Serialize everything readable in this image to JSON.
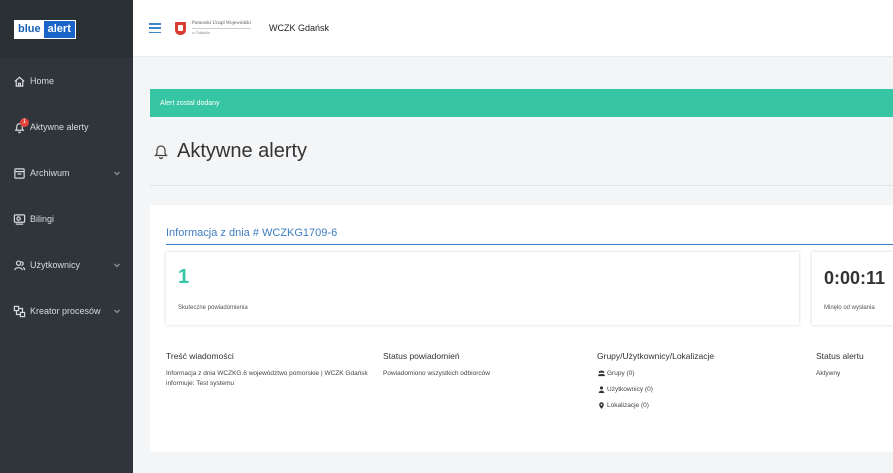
{
  "logo": {
    "part1": "blue",
    "part2": "alert"
  },
  "sidebar": {
    "items": [
      {
        "label": "Home",
        "icon": "home-icon",
        "chevron": false
      },
      {
        "label": "Aktywne alerty",
        "icon": "bell-icon",
        "chevron": false,
        "badge": "1"
      },
      {
        "label": "Archiwum",
        "icon": "archive-icon",
        "chevron": true
      },
      {
        "label": "Bilingi",
        "icon": "billing-icon",
        "chevron": false
      },
      {
        "label": "Użytkownicy",
        "icon": "users-icon",
        "chevron": true
      },
      {
        "label": "Kreator procesów",
        "icon": "process-icon",
        "chevron": true
      }
    ]
  },
  "topbar": {
    "office_line1": "Pomorski Urząd Wojewódzki",
    "office_line2": "w Gdańsku",
    "org_name": "WCZK Gdańsk"
  },
  "notification": {
    "text": "Alert został dodany"
  },
  "page": {
    "title": "Aktywne alerty"
  },
  "panel": {
    "heading": "Informacja z dnia # WCZKG1709-6",
    "stat_sent": {
      "value": "1",
      "label": "Skuteczne powiadomienia"
    },
    "stat_time": {
      "value": "0:00:11",
      "label": "Minęło od wysłania"
    },
    "columns": {
      "message": {
        "header": "Treść wiadomości",
        "text": "Informacja z dnia WCZKG.6 województwo pomorskie | WCZK Gdańsk informuje: Test systemu"
      },
      "status": {
        "header": "Status powiadomień",
        "text": "Powiadomiono wszystkich odbiorców"
      },
      "groups": {
        "header": "Grupy/Użytkownicy/Lokalizacje",
        "groups_label": "Grupy (0)",
        "users_label": "Użytkownicy (0)",
        "locations_label": "Lokalizacje (0)"
      },
      "alert_status": {
        "header": "Status alertu",
        "text": "Aktywny"
      }
    }
  },
  "colors": {
    "sidebar_bg": "#2f353b",
    "success": "#36c6a4",
    "link": "#3e7cc0",
    "badge": "#e0433a"
  }
}
